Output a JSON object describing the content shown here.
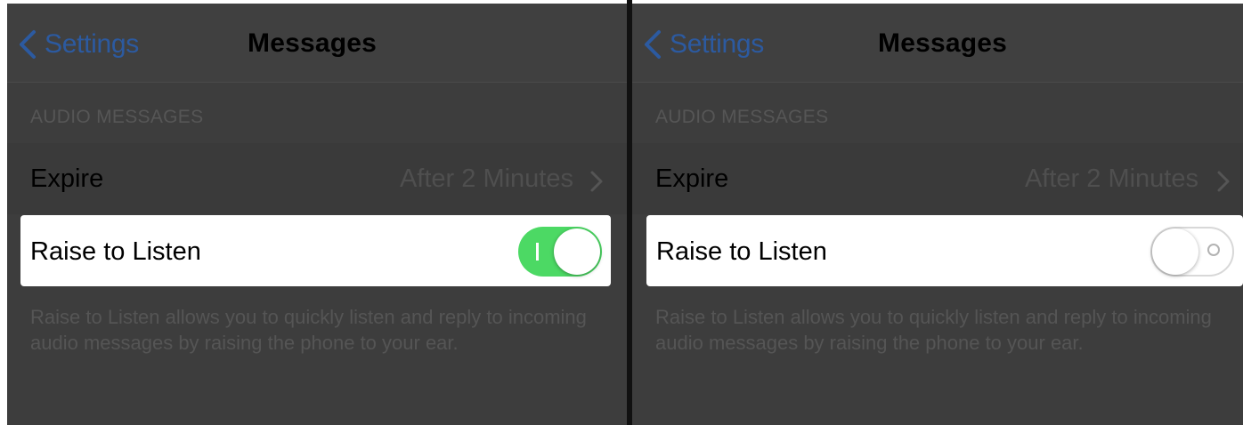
{
  "panels": [
    {
      "nav": {
        "back_label": "Settings",
        "title": "Messages"
      },
      "section_header": "AUDIO MESSAGES",
      "expire": {
        "label": "Expire",
        "value": "After 2 Minutes"
      },
      "raise": {
        "label": "Raise to Listen",
        "toggle_state": "on"
      },
      "footer": "Raise to Listen allows you to quickly listen and reply to incoming audio messages by raising the phone to your ear."
    },
    {
      "nav": {
        "back_label": "Settings",
        "title": "Messages"
      },
      "section_header": "AUDIO MESSAGES",
      "expire": {
        "label": "Expire",
        "value": "After 2 Minutes"
      },
      "raise": {
        "label": "Raise to Listen",
        "toggle_state": "off"
      },
      "footer": "Raise to Listen allows you to quickly listen and reply to incoming audio messages by raising the phone to your ear."
    }
  ],
  "colors": {
    "accent_blue": "#2c5aa0",
    "toggle_on_green": "#4cd964",
    "panel_background": "#3d3d3d"
  },
  "icons": [
    "chevron-left-icon",
    "chevron-right-icon"
  ]
}
